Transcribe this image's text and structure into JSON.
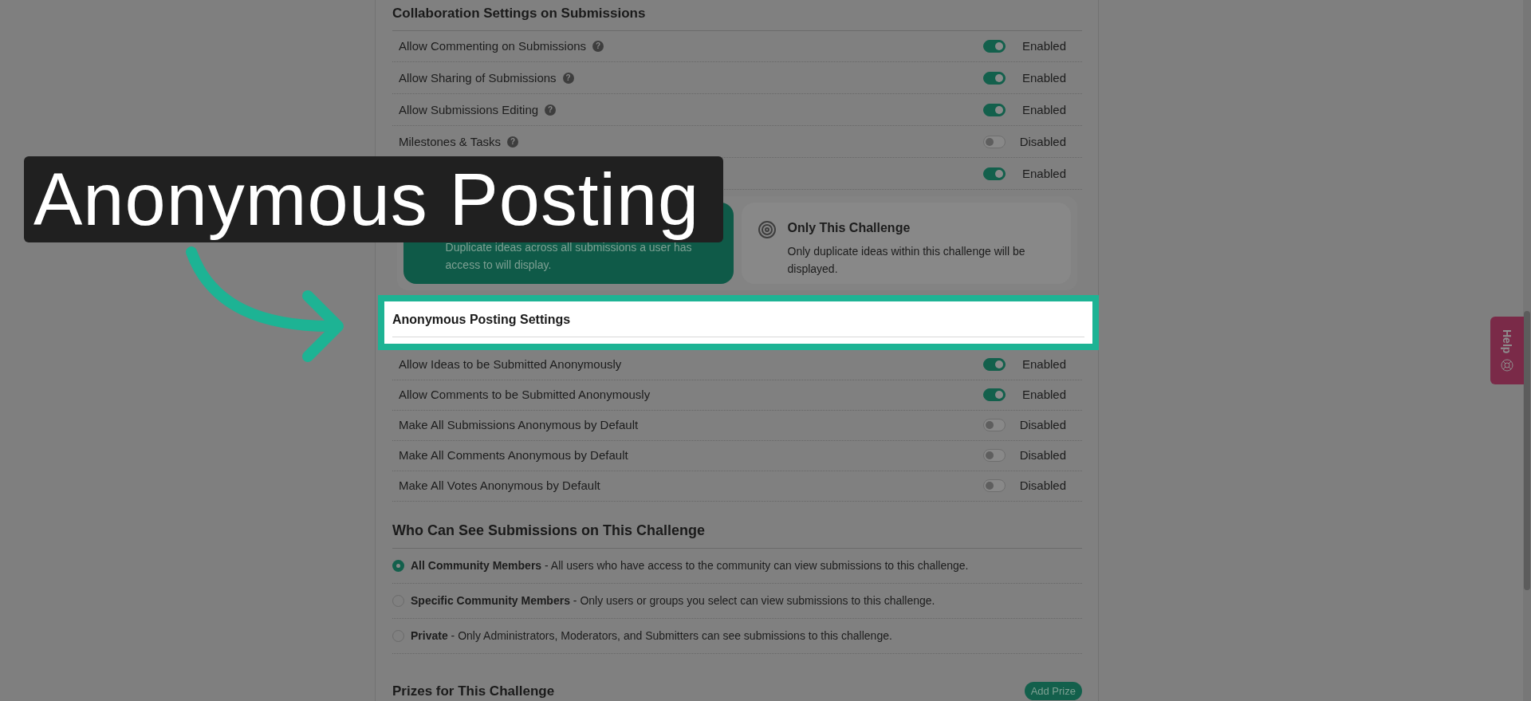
{
  "overlay_caption": "Anonymous Posting",
  "collaboration": {
    "title": "Collaboration Settings on Submissions",
    "rows": [
      {
        "label": "Allow Commenting on Submissions",
        "help": "?",
        "on": true,
        "status": "Enabled"
      },
      {
        "label": "Allow Sharing of Submissions",
        "help": "?",
        "on": true,
        "status": "Enabled"
      },
      {
        "label": "Allow Submissions Editing",
        "help": "?",
        "on": true,
        "status": "Enabled"
      },
      {
        "label": "Milestones & Tasks",
        "help": "?",
        "on": false,
        "status": "Disabled"
      },
      {
        "on": true,
        "status": "Enabled"
      }
    ],
    "scope_cards": [
      {
        "description": "Duplicate ideas across all submissions a user has access to will display.",
        "selected": true
      },
      {
        "title": "Only This Challenge",
        "description": "Only duplicate ideas within this challenge will be displayed.",
        "selected": false
      }
    ]
  },
  "anonymous": {
    "title": "Anonymous Posting Settings",
    "highlighted": true,
    "rows": [
      {
        "label": "Allow Ideas to be Submitted Anonymously",
        "on": true,
        "status": "Enabled"
      },
      {
        "label": "Allow Comments to be Submitted Anonymously",
        "on": true,
        "status": "Enabled"
      },
      {
        "label": "Make All Submissions Anonymous by Default",
        "on": false,
        "status": "Disabled"
      },
      {
        "label": "Make All Comments Anonymous by Default",
        "on": false,
        "status": "Disabled"
      },
      {
        "label": "Make All Votes Anonymous by Default",
        "on": false,
        "status": "Disabled"
      }
    ]
  },
  "visibility": {
    "title": "Who Can See Submissions on This Challenge",
    "options": [
      {
        "label": "All Community Members",
        "description": "- All users who have access to the community can view submissions to this challenge.",
        "selected": true
      },
      {
        "label": "Specific Community Members",
        "description": "- Only users or groups you select can view submissions to this challenge.",
        "selected": false
      },
      {
        "label": "Private",
        "description": "- Only Administrators, Moderators, and Submitters can see submissions to this challenge.",
        "selected": false
      }
    ]
  },
  "prizes": {
    "title": "Prizes for This Challenge",
    "button": "Add Prize"
  },
  "help_tab": {
    "label": "Help"
  }
}
